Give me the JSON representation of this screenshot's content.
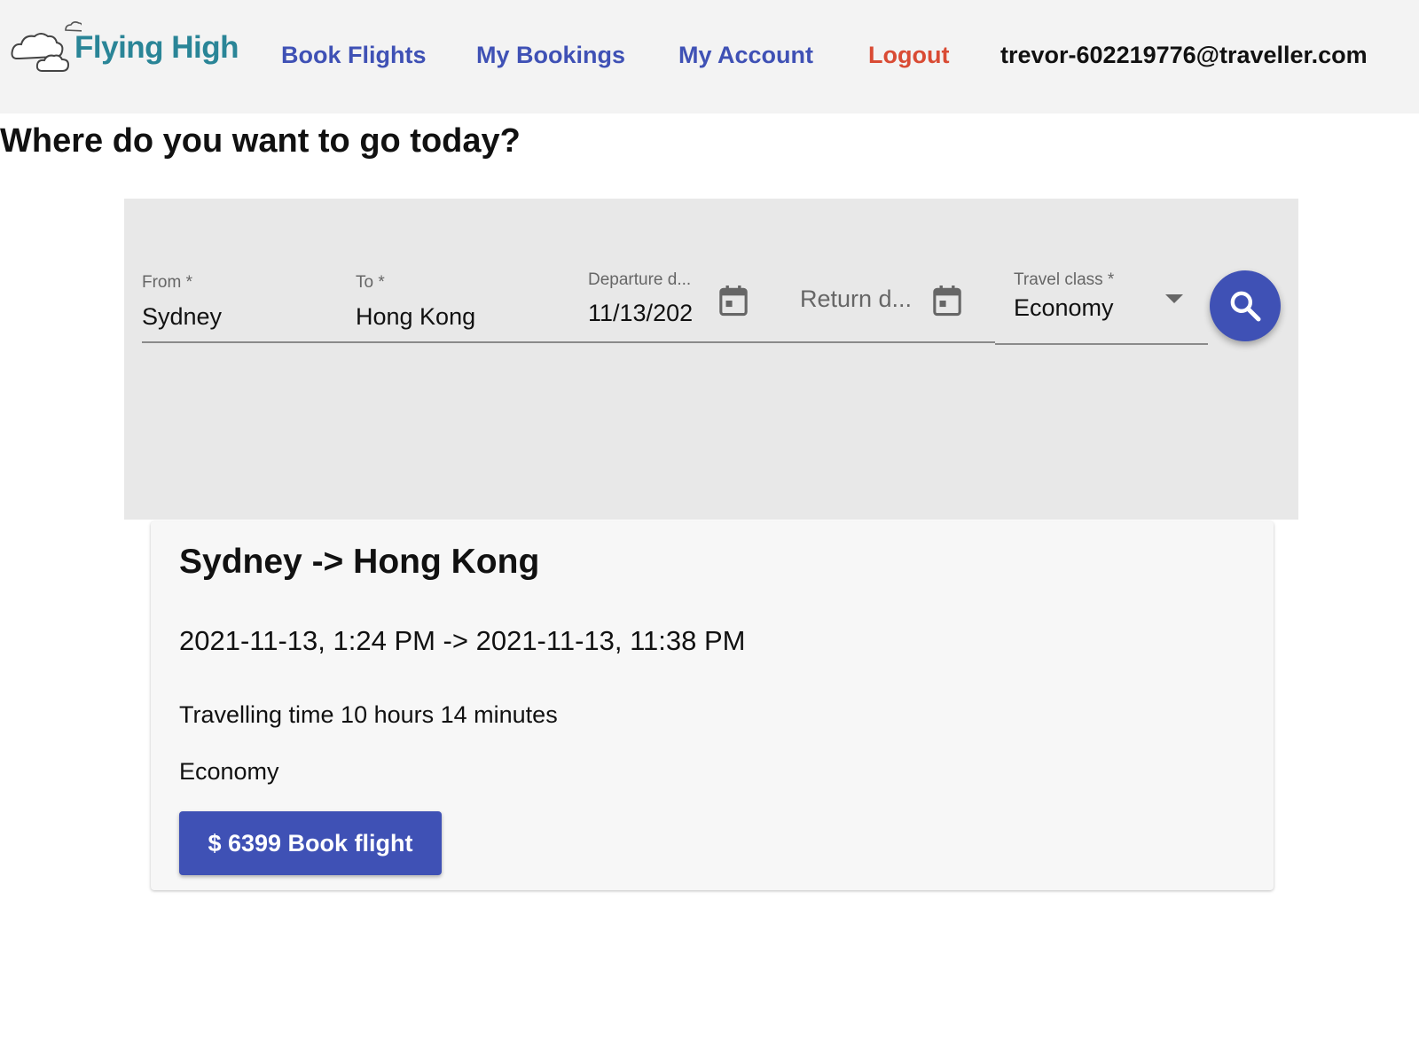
{
  "header": {
    "logo_text": "Flying High",
    "nav": {
      "book_flights": "Book Flights",
      "my_bookings": "My Bookings",
      "my_account": "My Account",
      "logout": "Logout"
    },
    "user_email": "trevor-602219776@traveller.com"
  },
  "page": {
    "heading": "Where do you want to go today?"
  },
  "search": {
    "from_label": "From *",
    "from_value": "Sydney",
    "to_label": "To *",
    "to_value": "Hong Kong",
    "departure_label": "Departure d...",
    "departure_value": "11/13/202",
    "return_placeholder": "Return d...",
    "class_label": "Travel class *",
    "class_value": "Economy",
    "icons": {
      "calendar": "calendar-icon",
      "dropdown": "dropdown-arrow-icon",
      "search": "search-icon"
    }
  },
  "result": {
    "route": "Sydney -> Hong Kong",
    "times": "2021-11-13, 1:24 PM -> 2021-11-13, 11:38 PM",
    "travel_time": "Travelling time 10 hours 14 minutes",
    "travel_class": "Economy",
    "book_button": "$ 6399 Book flight"
  },
  "colors": {
    "primary": "#3f51b5",
    "logout": "#d94b34",
    "logo": "#2a8597",
    "panel_bg": "#e8e8e8",
    "header_bg": "#f3f3f3"
  }
}
